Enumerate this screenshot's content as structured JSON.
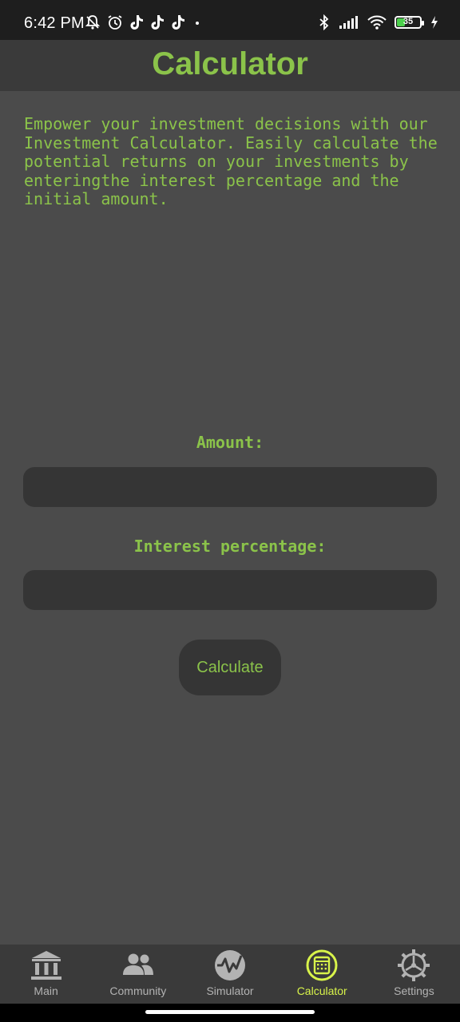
{
  "status_bar": {
    "time": "6:42 PM",
    "battery_level": "35",
    "battery_fraction": 0.35,
    "icons_left": [
      "muted-bell-icon",
      "alarm-icon",
      "tiktok-icon",
      "tiktok-icon",
      "tiktok-icon",
      "dot-icon"
    ],
    "icons_right": [
      "bluetooth-icon",
      "signal-icon",
      "wifi-icon",
      "battery-icon",
      "charging-icon"
    ]
  },
  "app_bar": {
    "title": "Calculator"
  },
  "intro_text": "Empower your investment decisions with our Investment Calculator. Easily calculate the potential returns on your investments by enteringthe interest percentage and the initial amount.",
  "form": {
    "amount_label": "Amount:",
    "amount_value": "",
    "interest_label": "Interest percentage:",
    "interest_value": "",
    "calculate_label": "Calculate"
  },
  "bottom_nav": {
    "items": [
      {
        "label": "Main",
        "icon": "bank-icon",
        "active": false
      },
      {
        "label": "Community",
        "icon": "people-icon",
        "active": false
      },
      {
        "label": "Simulator",
        "icon": "chart-wave-icon",
        "active": false
      },
      {
        "label": "Calculator",
        "icon": "calculator-icon",
        "active": true
      },
      {
        "label": "Settings",
        "icon": "gear-icon",
        "active": false
      }
    ]
  },
  "colors": {
    "accent": "#8bc34a",
    "active_nav": "#d8f34a",
    "background": "#4b4b4b",
    "surface": "#3a3a3a",
    "input": "#353535"
  }
}
